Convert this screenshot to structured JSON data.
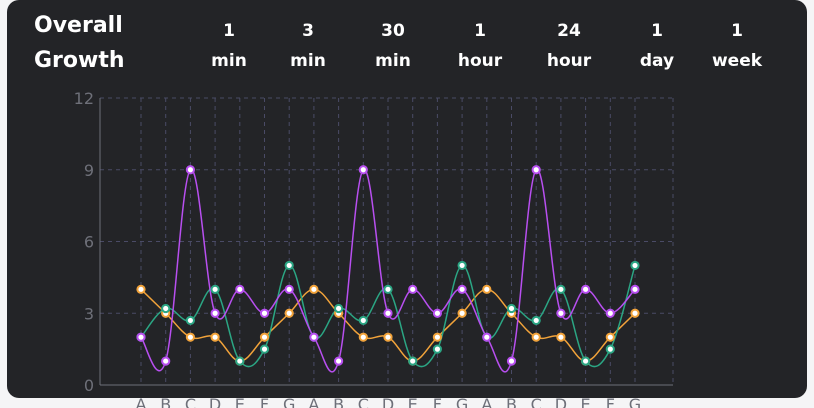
{
  "header": {
    "title_line1": "Overall",
    "title_line2": "Growth"
  },
  "ranges": [
    {
      "line1": "1",
      "line2": "min"
    },
    {
      "line1": "3",
      "line2": "min"
    },
    {
      "line1": "30",
      "line2": "min"
    },
    {
      "line1": "1",
      "line2": "hour"
    },
    {
      "line1": "24",
      "line2": "hour"
    },
    {
      "line1": "1",
      "line2": "day"
    },
    {
      "line1": "1",
      "line2": "week"
    }
  ],
  "colors": {
    "background": "#232427",
    "grid": "#4a4b66",
    "axis": "#6e7079",
    "series_purple": "#b84ff0",
    "series_green": "#2ba684",
    "series_orange": "#f2a33a"
  },
  "chart_data": {
    "type": "line",
    "categories": [
      "A",
      "B",
      "C",
      "D",
      "E",
      "F",
      "G",
      "A",
      "B",
      "C",
      "D",
      "E",
      "F",
      "G",
      "A",
      "B",
      "C",
      "D",
      "E",
      "F",
      "G"
    ],
    "ylim": [
      0,
      12
    ],
    "yticks": [
      0,
      3,
      6,
      9,
      12
    ],
    "grid": true,
    "series": [
      {
        "color": "#b84ff0",
        "values": [
          2,
          1,
          9,
          3,
          4,
          3,
          4,
          2,
          1,
          9,
          3,
          4,
          3,
          4,
          2,
          1,
          9,
          3,
          4,
          3,
          4
        ]
      },
      {
        "color": "#2ba684",
        "values": [
          2,
          3.2,
          2.7,
          4,
          1,
          1.5,
          5,
          2,
          3.2,
          2.7,
          4,
          1,
          1.5,
          5,
          2,
          3.2,
          2.7,
          4,
          1,
          1.5,
          5
        ]
      },
      {
        "color": "#f2a33a",
        "values": [
          4,
          3,
          2,
          2,
          1,
          2,
          3,
          4,
          3,
          2,
          2,
          1,
          2,
          3,
          4,
          3,
          2,
          2,
          1,
          2,
          3
        ]
      }
    ]
  }
}
